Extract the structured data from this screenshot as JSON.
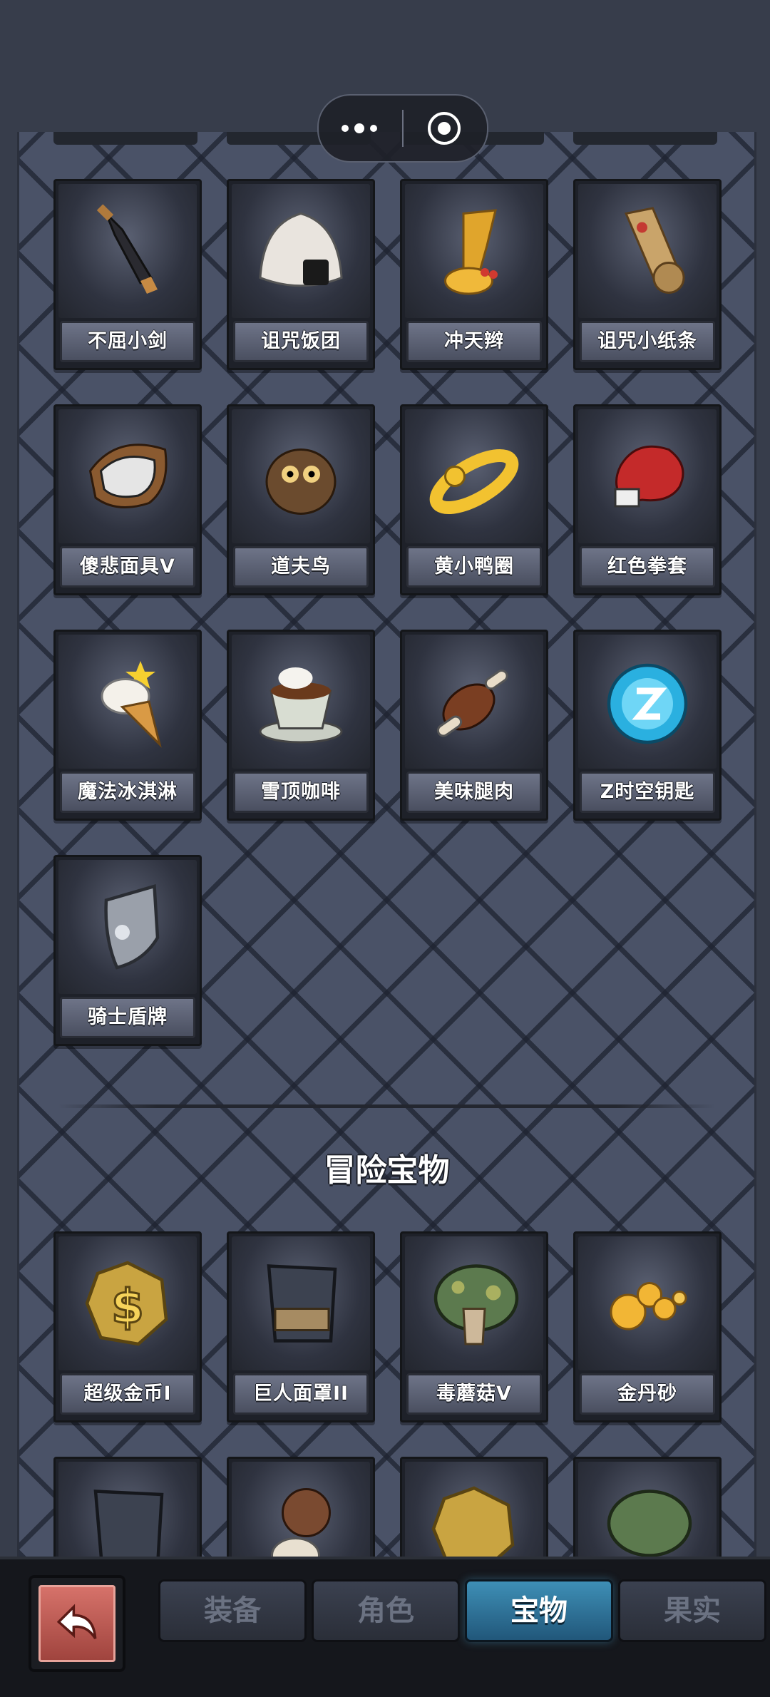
{
  "capsule": {
    "more_icon": "more-dots-icon",
    "close_icon": "target-circle-icon"
  },
  "items": [
    {
      "label": "不屈小剑",
      "icon": "sword-icon"
    },
    {
      "label": "诅咒饭团",
      "icon": "rice-ball-icon"
    },
    {
      "label": "冲天辫",
      "icon": "hair-tuft-icon"
    },
    {
      "label": "诅咒小纸条",
      "icon": "scroll-icon"
    },
    {
      "label": "傻悲面具V",
      "icon": "mask-icon"
    },
    {
      "label": "道夫鸟",
      "icon": "owl-icon"
    },
    {
      "label": "黄小鸭圈",
      "icon": "swim-ring-icon"
    },
    {
      "label": "红色拳套",
      "icon": "boxing-glove-icon"
    },
    {
      "label": "魔法冰淇淋",
      "icon": "ice-cream-icon"
    },
    {
      "label": "雪顶咖啡",
      "icon": "coffee-cup-icon"
    },
    {
      "label": "美味腿肉",
      "icon": "meat-leg-icon"
    },
    {
      "label": "Z时空钥匙",
      "icon": "z-orb-icon"
    },
    {
      "label": "骑士盾牌",
      "icon": "knight-shield-icon"
    }
  ],
  "section_title": "冒险宝物",
  "adventure_items": [
    {
      "label": "超级金币I",
      "icon": "gold-coin-icon"
    },
    {
      "label": "巨人面罩II",
      "icon": "giant-mask-icon"
    },
    {
      "label": "毒蘑菇V",
      "icon": "poison-mushroom-icon"
    },
    {
      "label": "金丹砂",
      "icon": "golden-pills-icon"
    }
  ],
  "bottom_nav": {
    "back_icon": "return-arrow-icon",
    "tabs": [
      {
        "label": "装备",
        "active": false
      },
      {
        "label": "角色",
        "active": false
      },
      {
        "label": "宝物",
        "active": true
      },
      {
        "label": "果实",
        "active": false
      }
    ]
  },
  "colors": {
    "accent": "#2f7aa3",
    "panel": "#4a5267",
    "back_button": "#c35a52"
  }
}
